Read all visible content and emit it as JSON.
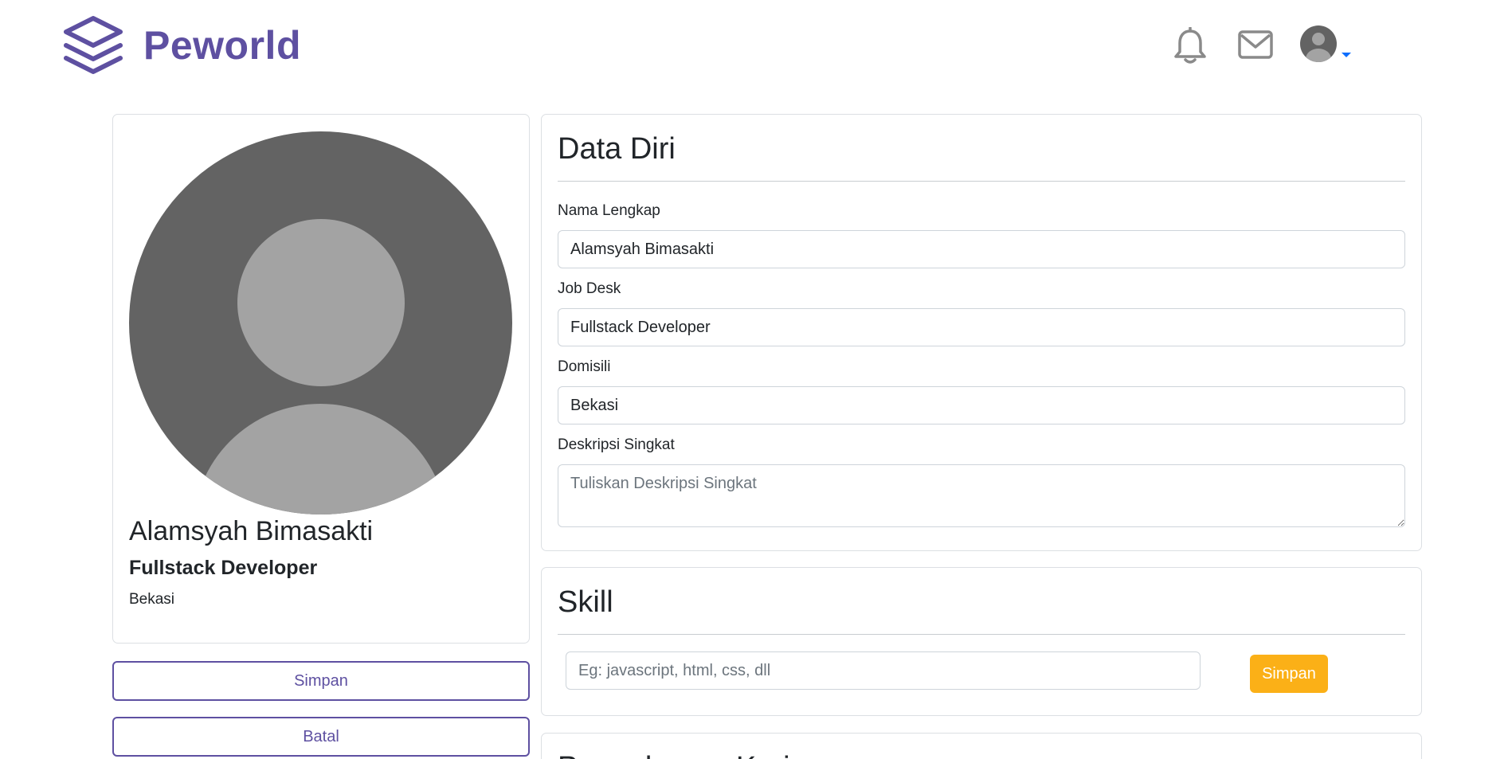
{
  "brand": {
    "name": "Peworld",
    "color": "#5e50a1"
  },
  "nav": {
    "icons": [
      "bell-icon",
      "mail-icon",
      "user-avatar-icon"
    ]
  },
  "profile": {
    "name": "Alamsyah Bimasakti",
    "job": "Fullstack Developer",
    "city": "Bekasi",
    "save_label": "Simpan",
    "cancel_label": "Batal"
  },
  "data_diri": {
    "title": "Data Diri",
    "fields": {
      "name_label": "Nama Lengkap",
      "name_value": "Alamsyah Bimasakti",
      "job_label": "Job Desk",
      "job_value": "Fullstack Developer",
      "domisili_label": "Domisili",
      "domisili_value": "Bekasi",
      "desc_label": "Deskripsi Singkat",
      "desc_placeholder": "Tuliskan Deskripsi Singkat"
    }
  },
  "skill": {
    "title": "Skill",
    "placeholder": "Eg: javascript, html, css, dll",
    "save_label": "Simpan",
    "button_color": "#fbb017"
  },
  "experience": {
    "title": "Pengalaman Kerja"
  }
}
